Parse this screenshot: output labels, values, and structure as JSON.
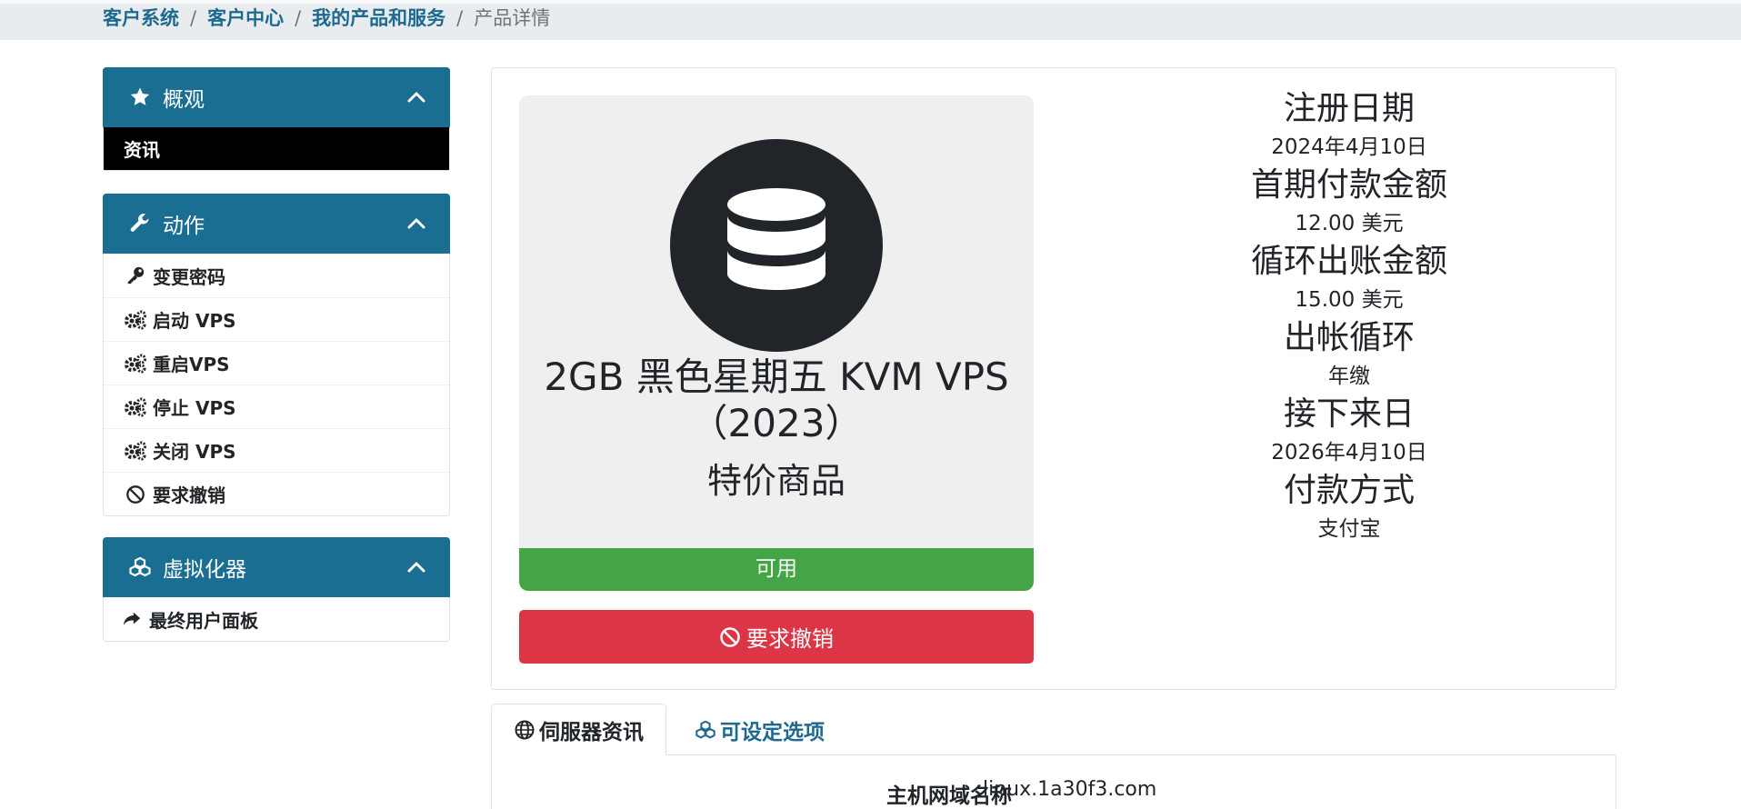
{
  "breadcrumb": {
    "items": [
      "客户系统",
      "客户中心",
      "我的产品和服务"
    ],
    "current": "产品详情"
  },
  "sidebar": {
    "overview": {
      "title": "概观",
      "items": [
        {
          "label": "资讯",
          "icon": "none"
        }
      ]
    },
    "actions": {
      "title": "动作",
      "items": [
        {
          "label": "变更密码",
          "icon": "key-icon"
        },
        {
          "label": "启动 VPS",
          "icon": "cogs-icon"
        },
        {
          "label": "重启VPS",
          "icon": "cogs-icon"
        },
        {
          "label": "停止 VPS",
          "icon": "cogs-icon"
        },
        {
          "label": "关闭 VPS",
          "icon": "cogs-icon"
        },
        {
          "label": "要求撤销",
          "icon": "ban-icon"
        }
      ]
    },
    "virtualizer": {
      "title": "虚拟化器",
      "items": [
        {
          "label": "最终用户面板",
          "icon": "share-icon"
        }
      ]
    }
  },
  "product": {
    "icon": "database-icon",
    "name": "2GB 黑色星期五 KVM VPS（2023）",
    "group": "特价商品",
    "status": "可用",
    "cancel_label": "要求撤销"
  },
  "info": {
    "registration_date_label": "注册日期",
    "registration_date": "2024年4月10日",
    "first_payment_label": "首期付款金额",
    "first_payment": "12.00 美元",
    "recurring_label": "循环出账金额",
    "recurring": "15.00 美元",
    "billing_cycle_label": "出帐循环",
    "billing_cycle": "年缴",
    "next_due_label": "接下来日",
    "next_due": "2026年4月10日",
    "payment_method_label": "付款方式",
    "payment_method": "支付宝"
  },
  "tabs": [
    {
      "label": "伺服器资讯",
      "icon": "globe-icon"
    },
    {
      "label": "可设定选项",
      "icon": "cubes-icon"
    }
  ],
  "server_info": {
    "hostname_label": "主机网域名称",
    "hostname": "linux.1a30f3.com"
  },
  "colors": {
    "panel_header": "#1a6e92",
    "link": "#1d6a8e",
    "status_active": "#44a547",
    "danger": "#dc3545"
  }
}
